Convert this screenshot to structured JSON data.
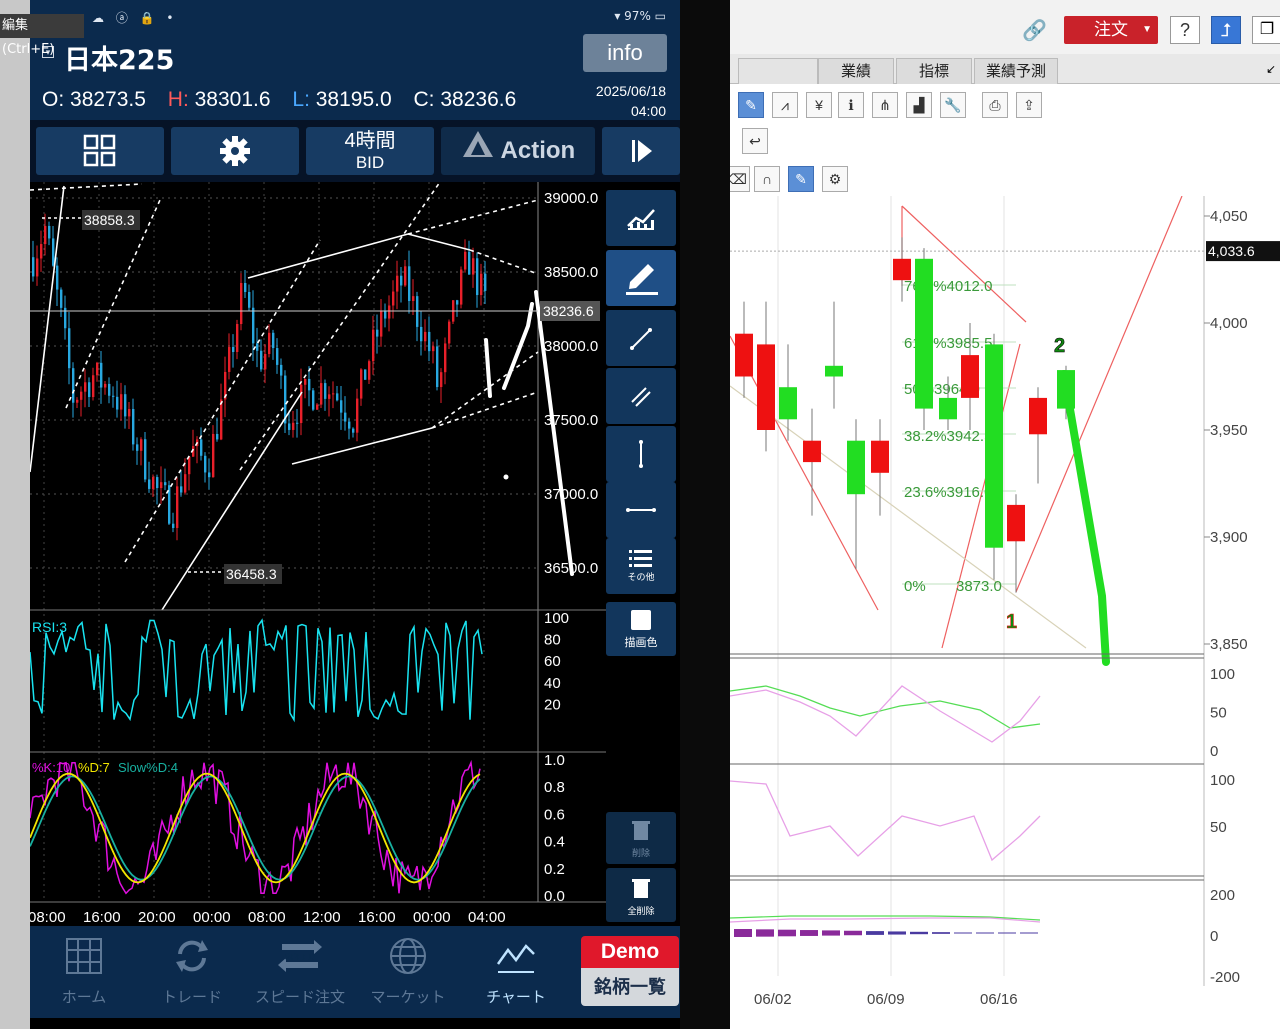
{
  "phone": {
    "status": {
      "battery": "97%"
    },
    "tooltip": "編集 (Ctrl+E)",
    "title": "日本225",
    "info_label": "info",
    "ohlc": [
      {
        "k": "O:",
        "v": "38273.5"
      },
      {
        "k": "H:",
        "v": "38301.6"
      },
      {
        "k": "L:",
        "v": "38195.0"
      },
      {
        "k": "C:",
        "v": "38236.6"
      }
    ],
    "date": "2025/06/18",
    "time": "04:00",
    "toolbar": {
      "period": "4時間",
      "price_type": "BID",
      "action": "Action"
    },
    "price_axis": [
      "39000.0",
      "38500.0",
      "38000.0",
      "37500.0",
      "37000.0",
      "36500.0"
    ],
    "current_price": "38236.6",
    "annotations": {
      "high": "38858.3",
      "low": "36458.3"
    },
    "rsi_label": "RSI:3",
    "rsi_axis": [
      "100",
      "80",
      "60",
      "40",
      "20"
    ],
    "stoch_labels": {
      "k": "%K:10",
      "d": "%D:7",
      "slow": "Slow%D:4"
    },
    "stoch_axis": [
      "1.0",
      "0.8",
      "0.6",
      "0.4",
      "0.2",
      "0.0"
    ],
    "time_axis": [
      "08:00",
      "16:00",
      "20:00",
      "00:00",
      "08:00",
      "12:00",
      "16:00",
      "00:00",
      "04:00"
    ],
    "side_tools": {
      "more": "その他",
      "color": "描画色",
      "delete": "削除",
      "delete_all": "全削除"
    },
    "nav": [
      {
        "label": "ホーム",
        "icon": "home-grid-icon"
      },
      {
        "label": "トレード",
        "icon": "trade-arrows-icon"
      },
      {
        "label": "スピード注文",
        "icon": "speed-icon"
      },
      {
        "label": "マーケット",
        "icon": "globe-icon"
      },
      {
        "label": "チャート",
        "icon": "chart-icon"
      }
    ],
    "demo": {
      "badge": "Demo",
      "list": "銘柄一覧"
    },
    "colors": {
      "up": "#e8202a",
      "down": "#28a8e0",
      "rsi": "#19e3f0",
      "k": "#e010e0",
      "d": "#f2e600",
      "slow": "#18b0a0",
      "header": "#0b2a4d"
    }
  },
  "desktop": {
    "order_label": "注文",
    "help_label": "?",
    "tabs": [
      "業績",
      "指標",
      "業績予測"
    ],
    "price_axis": [
      "4,050",
      "4,000",
      "3,950",
      "3,900",
      "3,850"
    ],
    "current_price": "4,033.6",
    "fib_labels": [
      "76.4%4012.0",
      "61.8%3985.5",
      "50%3964.0",
      "38.2%3942.5",
      "23.6%3916.0",
      "0%",
      "3873.0"
    ],
    "wave_labels": [
      "2",
      "1"
    ],
    "osc1_axis": [
      "100",
      "50",
      "0"
    ],
    "osc2_axis": [
      "100",
      "50"
    ],
    "osc3_axis": [
      "200",
      "0",
      "-200"
    ],
    "date_axis": [
      "06/02",
      "06/09",
      "06/16"
    ],
    "colors": {
      "up": "#22dd22",
      "down": "#ee1111",
      "fib": "#3a9a3a",
      "trend": "#ee6060"
    }
  }
}
